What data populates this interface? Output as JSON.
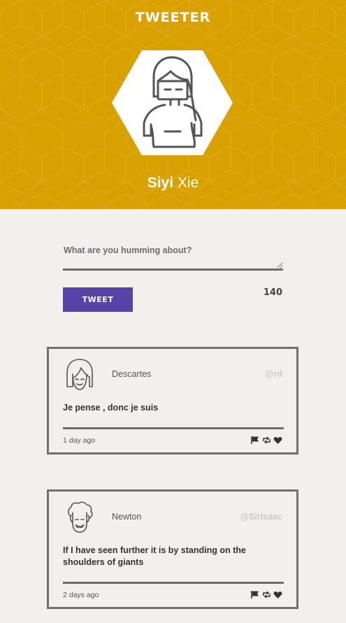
{
  "header": {
    "app_title": "TWEETER",
    "background": "#d9a100",
    "profile": {
      "first_name": "Siyi",
      "last_name": "Xie"
    }
  },
  "compose": {
    "placeholder": "What are you humming about?",
    "value": "",
    "tweet_button_label": "TWEET",
    "char_count": "140",
    "button_color": "#5744a8"
  },
  "tweets": [
    {
      "name": "Descartes",
      "handle": "@rd",
      "text": "Je pense , donc je suis",
      "time": "1 day ago",
      "actions": [
        "flag-icon",
        "retweet-icon",
        "heart-icon"
      ]
    },
    {
      "name": "Newton",
      "handle": "@SirIsaac",
      "text": "If I have seen further it is by standing on the shoulders of giants",
      "time": "2 days ago",
      "actions": [
        "flag-icon",
        "retweet-icon",
        "heart-icon"
      ]
    }
  ]
}
